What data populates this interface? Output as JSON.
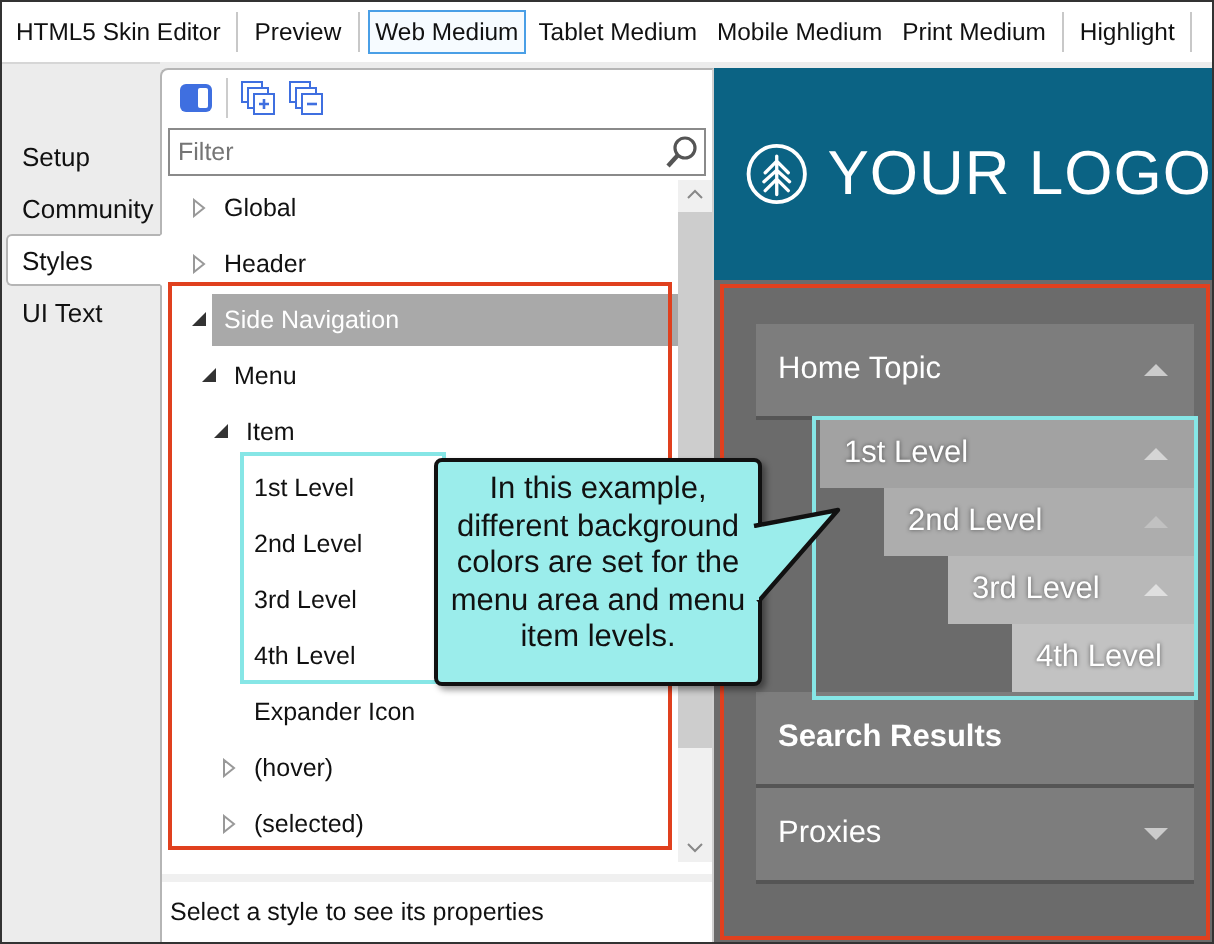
{
  "toolbar": {
    "items": [
      {
        "kind": "tab",
        "label": "HTML5 Skin Editor",
        "selected": false
      },
      {
        "kind": "separator"
      },
      {
        "kind": "tab",
        "label": "Preview",
        "selected": false
      },
      {
        "kind": "separator"
      },
      {
        "kind": "tab",
        "label": "Web Medium",
        "selected": true
      },
      {
        "kind": "tab",
        "label": "Tablet Medium",
        "selected": false
      },
      {
        "kind": "tab",
        "label": "Mobile Medium",
        "selected": false
      },
      {
        "kind": "tab",
        "label": "Print Medium",
        "selected": false
      },
      {
        "kind": "separator"
      },
      {
        "kind": "tab",
        "label": "Highlight",
        "selected": false
      },
      {
        "kind": "separator"
      }
    ]
  },
  "side_tabs": [
    {
      "label": "Setup",
      "selected": false
    },
    {
      "label": "Community",
      "selected": false
    },
    {
      "label": "Styles",
      "selected": true
    },
    {
      "label": "UI Text",
      "selected": false
    }
  ],
  "styles_panel": {
    "filter": {
      "placeholder": "Filter"
    },
    "tree": [
      {
        "label": "Global",
        "expanded": false,
        "selected": false
      },
      {
        "label": "Header",
        "expanded": false,
        "selected": false
      },
      {
        "label": "Side Navigation",
        "expanded": true,
        "selected": true,
        "children": [
          {
            "label": "Menu",
            "expanded": true,
            "selected": false,
            "children": [
              {
                "label": "Item",
                "expanded": true,
                "selected": false,
                "children": [
                  {
                    "label": "1st Level",
                    "selected": false
                  },
                  {
                    "label": "2nd Level",
                    "selected": false
                  },
                  {
                    "label": "3rd Level",
                    "selected": false
                  },
                  {
                    "label": "4th Level",
                    "selected": false
                  },
                  {
                    "label": "Expander Icon",
                    "selected": false
                  },
                  {
                    "label": "(hover)",
                    "expanded": false,
                    "selected": false
                  },
                  {
                    "label": "(selected)",
                    "expanded": false,
                    "selected": false
                  }
                ]
              }
            ]
          }
        ]
      }
    ],
    "status": "Select a style to see its properties"
  },
  "preview": {
    "logo_text": "YOUR LOGO",
    "menu": [
      {
        "label": "Home Topic",
        "bold": false,
        "expanded": true,
        "children": [
          {
            "label": "1st Level",
            "expanded": true,
            "children": [
              {
                "label": "2nd Level",
                "expanded": true,
                "children": [
                  {
                    "label": "3rd Level",
                    "expanded": true,
                    "children": [
                      {
                        "label": "4th Level"
                      }
                    ]
                  }
                ]
              }
            ]
          }
        ]
      },
      {
        "label": "Search Results",
        "bold": true
      },
      {
        "label": "Proxies",
        "bold": false,
        "expanded": false
      }
    ]
  },
  "callout": {
    "text": "In this example, different background colors are set for the menu area and menu item levels."
  }
}
